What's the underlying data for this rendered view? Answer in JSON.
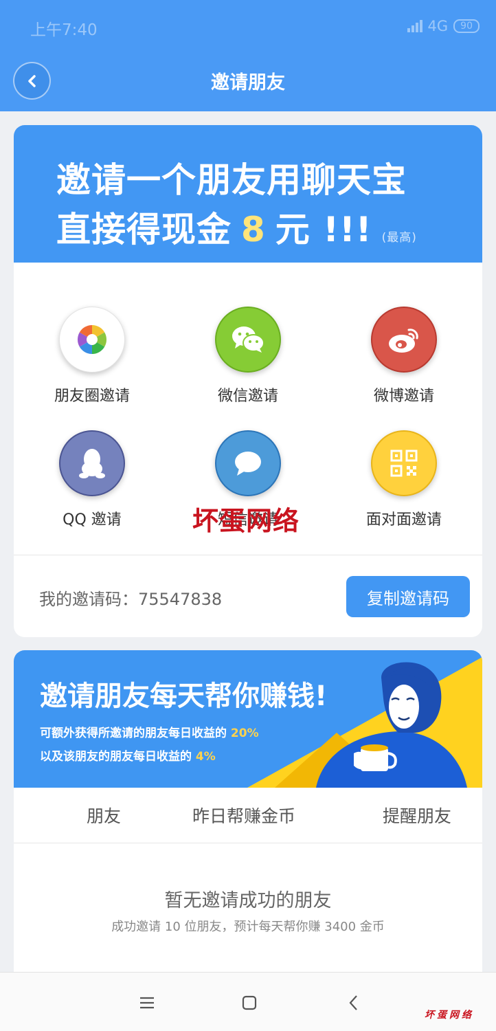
{
  "status_bar": {
    "time": "上午7:40",
    "network": "4G",
    "battery": "90"
  },
  "header": {
    "title": "邀请朋友"
  },
  "invite_banner": {
    "line1": "邀请一个朋友用聊天宝",
    "line2_prefix": "直接得现金",
    "amount": "8",
    "line2_suffix": "元 !!!",
    "note": "(最高)"
  },
  "share_options": [
    {
      "label": "朋友圈邀请",
      "icon": "moments-icon",
      "color": "#ffffff"
    },
    {
      "label": "微信邀请",
      "icon": "wechat-icon",
      "color": "#86cc35"
    },
    {
      "label": "微博邀请",
      "icon": "weibo-icon",
      "color": "#d9564a"
    },
    {
      "label": "QQ 邀请",
      "icon": "qq-icon",
      "color": "#7582bd"
    },
    {
      "label": "短信邀请",
      "icon": "sms-icon",
      "color": "#4d9bd9"
    },
    {
      "label": "面对面邀请",
      "icon": "qr-code-icon",
      "color": "#ffd13d"
    }
  ],
  "watermark": "坏蛋网络",
  "invite_code": {
    "label": "我的邀请码：75547838",
    "copy_button": "复制邀请码"
  },
  "earn_banner": {
    "title": "邀请朋友每天帮你赚钱!",
    "line1_prefix": "可额外获得所邀请的朋友每日收益的",
    "line1_pct": "20%",
    "line2_prefix": "以及该朋友的朋友每日收益的",
    "line2_pct": "4%"
  },
  "tabs": [
    "朋友",
    "昨日帮赚金币",
    "提醒朋友"
  ],
  "empty_state": {
    "title": "暂无邀请成功的朋友",
    "subtitle": "成功邀请 10 位朋友，预计每天帮你赚 3400 金币"
  },
  "corner_watermark": "坏蛋网络",
  "colors": {
    "primary": "#4297f3",
    "highlight": "#ffe47a",
    "watermark": "#c9141f"
  }
}
